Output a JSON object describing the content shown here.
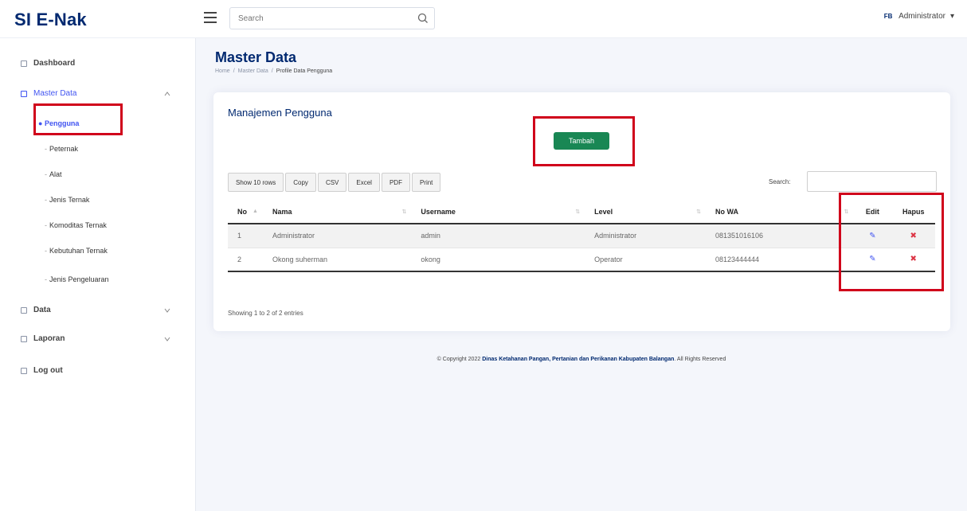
{
  "app": {
    "brand": "SI E-Nak"
  },
  "header": {
    "search_placeholder": "Search",
    "user_name": "Administrator",
    "user_initials": "FB"
  },
  "sidebar": {
    "dashboard": "Dashboard",
    "master_data": "Master Data",
    "pengguna": "Pengguna",
    "sub_items": [
      "Peternak",
      "Alat",
      "Jenis Ternak",
      "Komoditas Ternak",
      "Kebutuhan Ternak",
      "Jenis Pengeluaran"
    ],
    "data": "Data",
    "laporan": "Laporan",
    "logout": "Log out"
  },
  "page": {
    "title": "Master Data",
    "breadcrumb": [
      "Home",
      "Master Data",
      "Profile Data Pengguna"
    ]
  },
  "card": {
    "title": "Manajemen Pengguna",
    "add_button": "Tambah",
    "export_buttons": [
      "Show 10 rows",
      "Copy",
      "CSV",
      "Excel",
      "PDF",
      "Print"
    ],
    "search_label": "Search:",
    "columns": [
      "No",
      "Nama",
      "Username",
      "Level",
      "No WA",
      "Edit",
      "Hapus"
    ],
    "rows": [
      {
        "no": "1",
        "nama": "Administrator",
        "username": "admin",
        "level": "Administrator",
        "wa": "081351016106"
      },
      {
        "no": "2",
        "nama": "Okong suherman",
        "username": "okong",
        "level": "Operator",
        "wa": "08123444444"
      }
    ],
    "info": "Showing 1 to 2 of 2 entries"
  },
  "footer": {
    "prefix": "© Copyright 2022",
    "org": "Dinas Ketahanan Pangan, Pertanian dan Perikanan Kabupaten Balangan",
    "suffix": ". All Rights Reserved"
  },
  "colors": {
    "brand": "#012970",
    "accent": "#4154f1",
    "add_button": "#198754",
    "highlight": "#d0021b"
  }
}
